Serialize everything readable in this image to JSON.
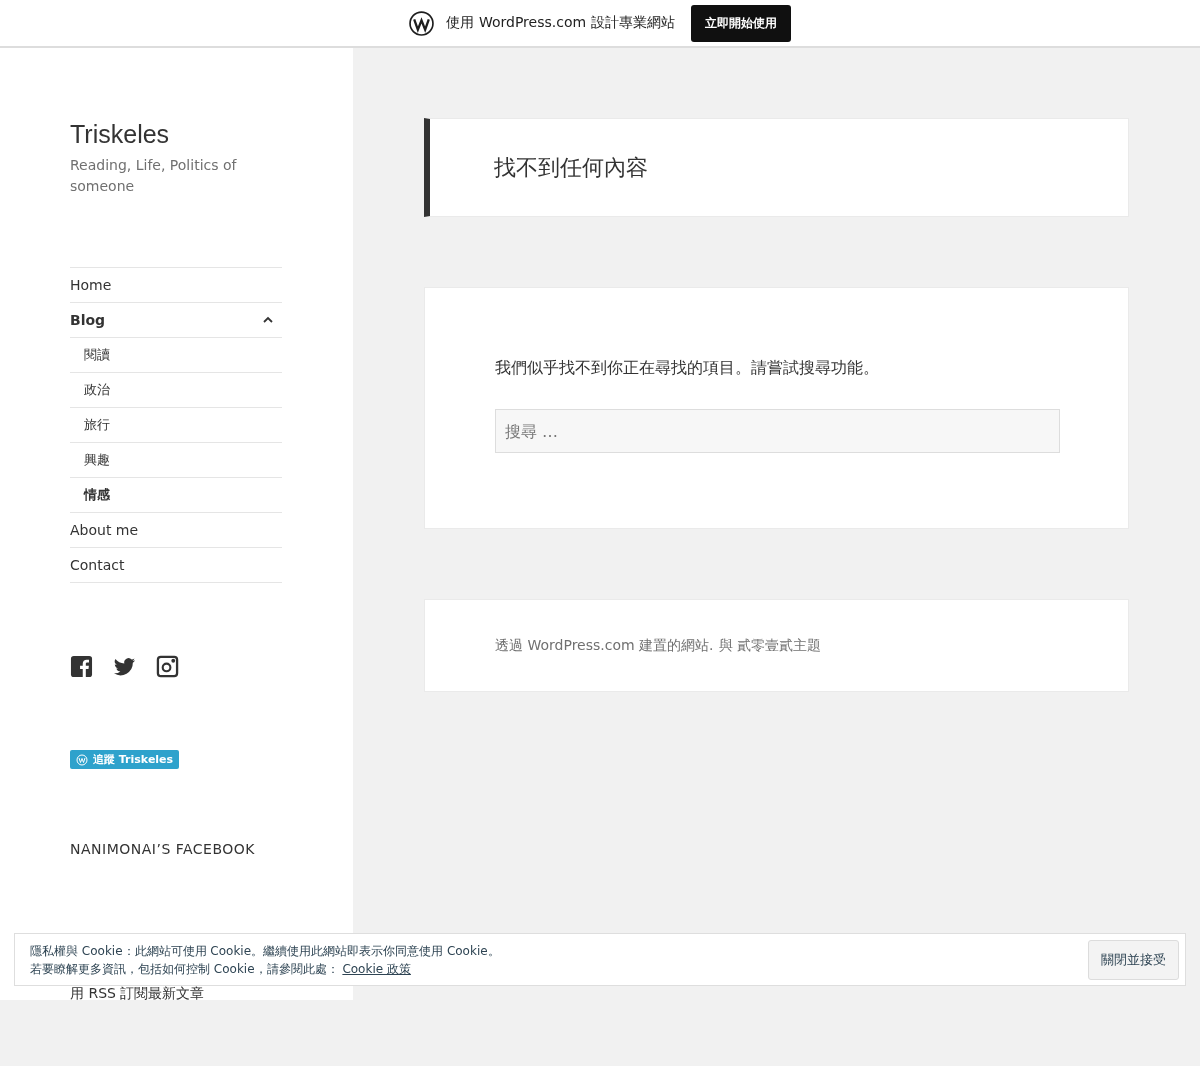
{
  "top_bar": {
    "text": "使用 WordPress.com 設計專業網站",
    "button": "立即開始使用"
  },
  "site": {
    "title": "Triskeles",
    "tagline": "Reading, Life, Politics of someone"
  },
  "menu": [
    {
      "label": "Home",
      "current": false
    },
    {
      "label": "Blog",
      "current": true,
      "expanded": true,
      "children": [
        {
          "label": "閱讀",
          "current": false
        },
        {
          "label": "政治",
          "current": false
        },
        {
          "label": "旅行",
          "current": false
        },
        {
          "label": "興趣",
          "current": false
        },
        {
          "label": "情感",
          "current": true
        }
      ]
    },
    {
      "label": "About me",
      "current": false
    },
    {
      "label": "Contact",
      "current": false
    }
  ],
  "social": [
    {
      "kind": "facebook"
    },
    {
      "kind": "twitter"
    },
    {
      "kind": "instagram"
    }
  ],
  "follow_button": "追蹤 Triskeles",
  "widget_title": "NANIMONAI’S FACEBOOK",
  "rss_text": "用 RSS 訂閱最新文章",
  "page_title": "找不到任何內容",
  "message": "我們似乎找不到你正在尋找的項目。請嘗試搜尋功能。",
  "search": {
    "placeholder": "搜尋 …"
  },
  "footer": {
    "text": "透過 WordPress.com 建置的網站.",
    "link": "與 貳零壹貳主題"
  },
  "cookie": {
    "line1": "隱私權與 Cookie：此網站可使用 Cookie。繼續使用此網站即表示你同意使用 Cookie。",
    "line2": "若要瞭解更多資訊，包括如何控制 Cookie，請參閱此處：",
    "link": "Cookie 政策",
    "button": "關閉並接受"
  }
}
